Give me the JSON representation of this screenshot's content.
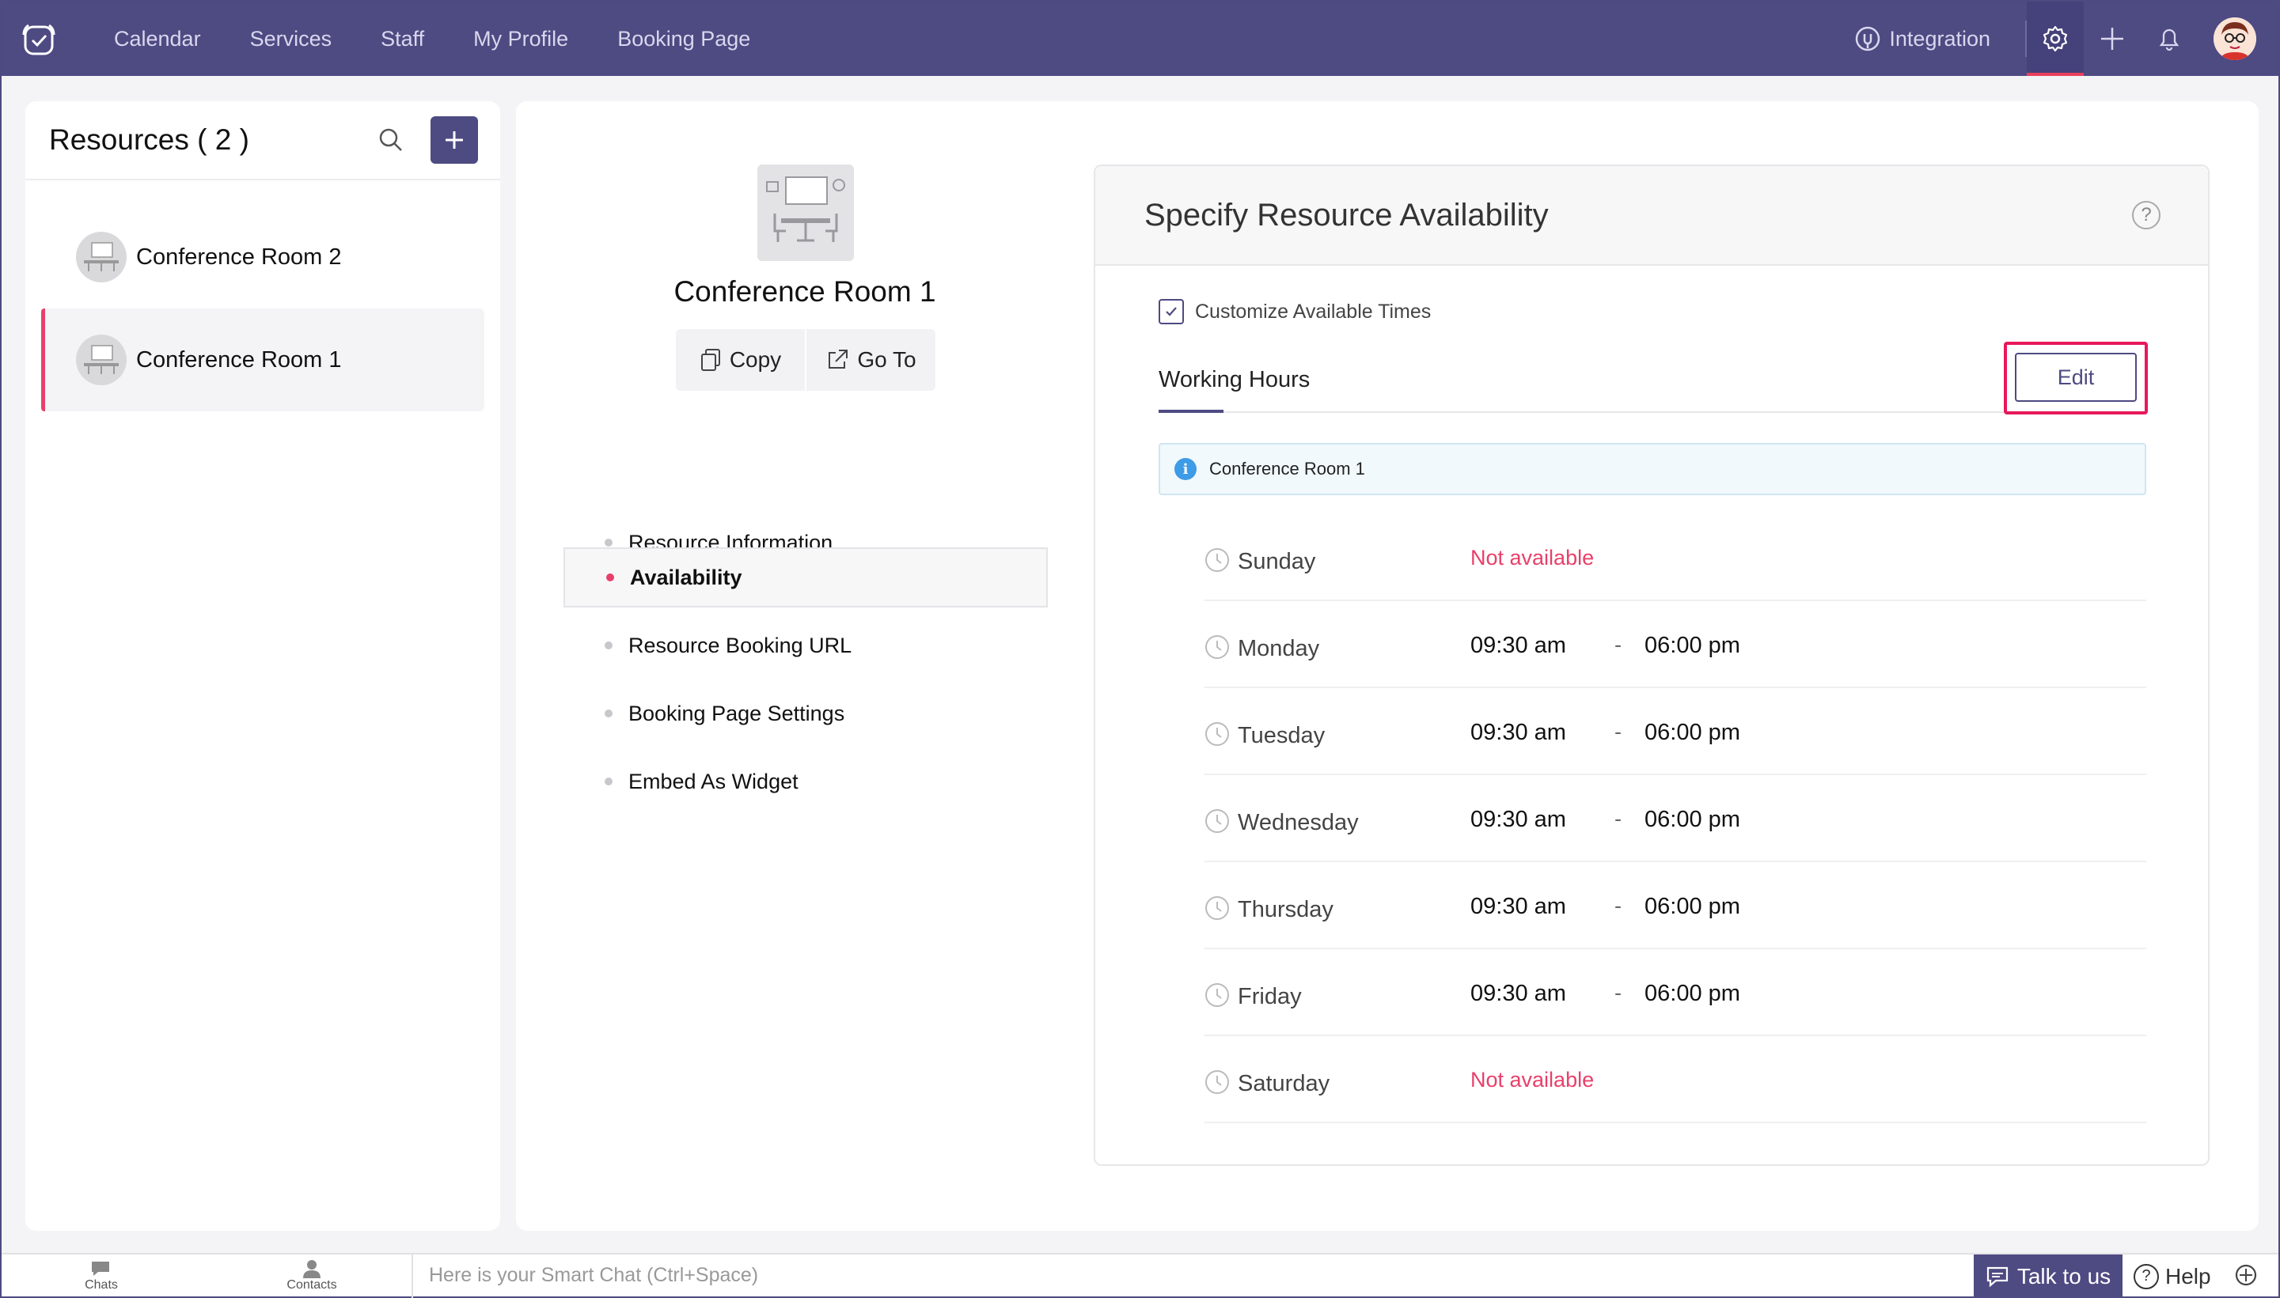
{
  "nav": {
    "items": [
      "Calendar",
      "Services",
      "Staff",
      "My Profile",
      "Booking Page"
    ],
    "integration": "Integration"
  },
  "resources": {
    "title": "Resources ( 2 )",
    "items": [
      {
        "name": "Conference Room 2",
        "selected": false
      },
      {
        "name": "Conference Room 1",
        "selected": true
      }
    ]
  },
  "profile": {
    "name": "Conference Room 1",
    "copy_label": "Copy",
    "goto_label": "Go To"
  },
  "menu": {
    "items": [
      {
        "label": "Resource Information",
        "selected": false
      },
      {
        "label": "Availability",
        "selected": true
      },
      {
        "label": "Resource Booking URL",
        "selected": false
      },
      {
        "label": "Booking Page Settings",
        "selected": false
      },
      {
        "label": "Embed As Widget",
        "selected": false
      }
    ]
  },
  "availability": {
    "title": "Specify Resource Availability",
    "customize_label": "Customize Available Times",
    "customize_checked": true,
    "working_hours_label": "Working Hours",
    "edit_label": "Edit",
    "info_resource": "Conference Room 1",
    "not_available": "Not available",
    "days": [
      {
        "day": "Sunday",
        "available": false
      },
      {
        "day": "Monday",
        "available": true,
        "from": "09:30 am",
        "to": "06:00 pm"
      },
      {
        "day": "Tuesday",
        "available": true,
        "from": "09:30 am",
        "to": "06:00 pm"
      },
      {
        "day": "Wednesday",
        "available": true,
        "from": "09:30 am",
        "to": "06:00 pm"
      },
      {
        "day": "Thursday",
        "available": true,
        "from": "09:30 am",
        "to": "06:00 pm"
      },
      {
        "day": "Friday",
        "available": true,
        "from": "09:30 am",
        "to": "06:00 pm"
      },
      {
        "day": "Saturday",
        "available": false
      }
    ],
    "dash": "-"
  },
  "bottom": {
    "chats": "Chats",
    "contacts": "Contacts",
    "smart_chat_placeholder": "Here is your Smart Chat (Ctrl+Space)",
    "talk": "Talk to us",
    "help": "Help"
  },
  "colors": {
    "nav_bg": "#4e4a82",
    "accent_pink": "#e8406a",
    "highlight_red": "#e8185b",
    "info_blue": "#3e9be6"
  }
}
